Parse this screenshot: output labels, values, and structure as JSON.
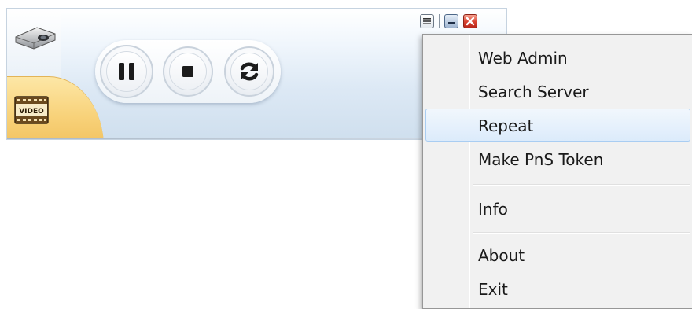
{
  "player": {
    "icons": {
      "app": "projector-icon",
      "media_type": "video-icon",
      "pause": "pause-icon",
      "stop": "stop-icon",
      "repeat": "repeat-icon",
      "menu": "menu-icon",
      "minimize": "minimize-icon",
      "close": "close-icon"
    },
    "video_badge_text": "VIDEO"
  },
  "context_menu": {
    "items": [
      {
        "label": "Web Admin"
      },
      {
        "label": "Search Server"
      },
      {
        "label": "Repeat"
      },
      {
        "label": "Make PnS Token"
      },
      {
        "label": "Info"
      },
      {
        "label": "About"
      },
      {
        "label": "Exit"
      }
    ],
    "highlighted": "Repeat"
  },
  "colors": {
    "panel_blue": "#dde9f5",
    "tab_yellow": "#f8d27a",
    "menu_highlight": "#dcebfb",
    "close_red": "#d84130"
  }
}
